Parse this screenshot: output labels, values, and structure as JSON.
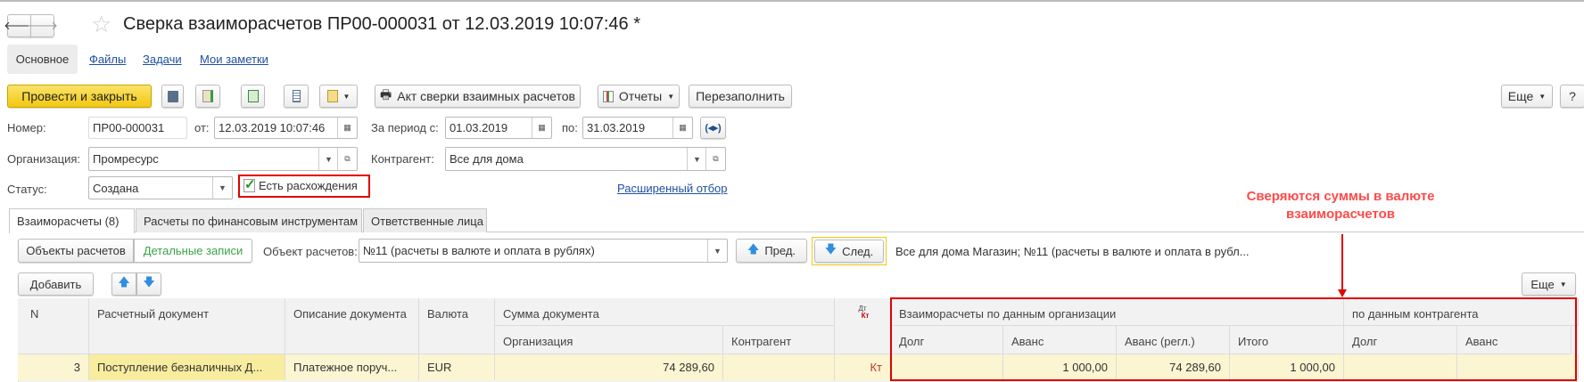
{
  "window": {
    "title": "Сверка взаиморасчетов ПР00-000031 от 12.03.2019 10:07:46 *"
  },
  "nav_tabs": [
    "Основное",
    "Файлы",
    "Задачи",
    "Мои заметки"
  ],
  "toolbar": {
    "post_close": "Провести и закрыть",
    "act": "Акт сверки взаимных расчетов",
    "reports": "Отчеты",
    "refill": "Перезаполнить",
    "more": "Еще",
    "help": "?"
  },
  "form": {
    "number_label": "Номер:",
    "number": "ПР00-000031",
    "from_label": "от:",
    "date": "12.03.2019 10:07:46",
    "period_label": "За период с:",
    "period_from": "01.03.2019",
    "to_label": "по:",
    "period_to": "31.03.2019",
    "org_label": "Организация:",
    "org": "Промресурс",
    "contractor_label": "Контрагент:",
    "contractor": "Все для дома",
    "status_label": "Статус:",
    "status": "Создана",
    "discrepancy_label": "Есть расхождения",
    "discrepancy_checked": true,
    "advanced_filter": "Расширенный отбор"
  },
  "annotation": {
    "line1": "Сверяются суммы в валюте",
    "line2": "взаиморасчетов",
    "color": "#ff4a4a"
  },
  "tabs": [
    "Взаиморасчеты (8)",
    "Расчеты по финансовым инструментам",
    "Ответственные лица"
  ],
  "subbar": {
    "objects": "Объекты расчетов",
    "details": "Детальные записи",
    "object_label": "Объект расчетов:",
    "object": "№11 (расчеты в валюте и оплата в рублях)",
    "prev": "Пред.",
    "next": "След.",
    "summary": "Все для дома Магазин; №11 (расчеты в валюте и оплата в рубл..."
  },
  "table_bar": {
    "add": "Добавить",
    "more": "Еще"
  },
  "table": {
    "headers": {
      "n": "N",
      "doc": "Расчетный документ",
      "desc": "Описание документа",
      "currency": "Валюта",
      "sum_group": "Сумма документа",
      "sum_org": "Организация",
      "sum_contr": "Контрагент",
      "dtkt_dt": "Дт",
      "dtkt_kt": "Кт",
      "org_group": "Взаиморасчеты по данным организации",
      "org_debt": "Долг",
      "org_adv": "Аванс",
      "org_adv_reg": "Аванс (регл.)",
      "org_total": "Итого",
      "contr_group": "по данным контрагента",
      "contr_debt": "Долг",
      "contr_adv": "Аванс"
    },
    "rows": [
      {
        "n": "3",
        "doc": "Поступление безналичных Д...",
        "desc": "Платежное поруч...",
        "currency": "EUR",
        "sum_org": "74 289,60",
        "sum_contr": "",
        "dtkt": "Кт",
        "org_debt": "",
        "org_adv": "1 000,00",
        "org_adv_reg": "74 289,60",
        "org_total": "1 000,00",
        "contr_debt": "",
        "contr_adv": ""
      }
    ]
  }
}
